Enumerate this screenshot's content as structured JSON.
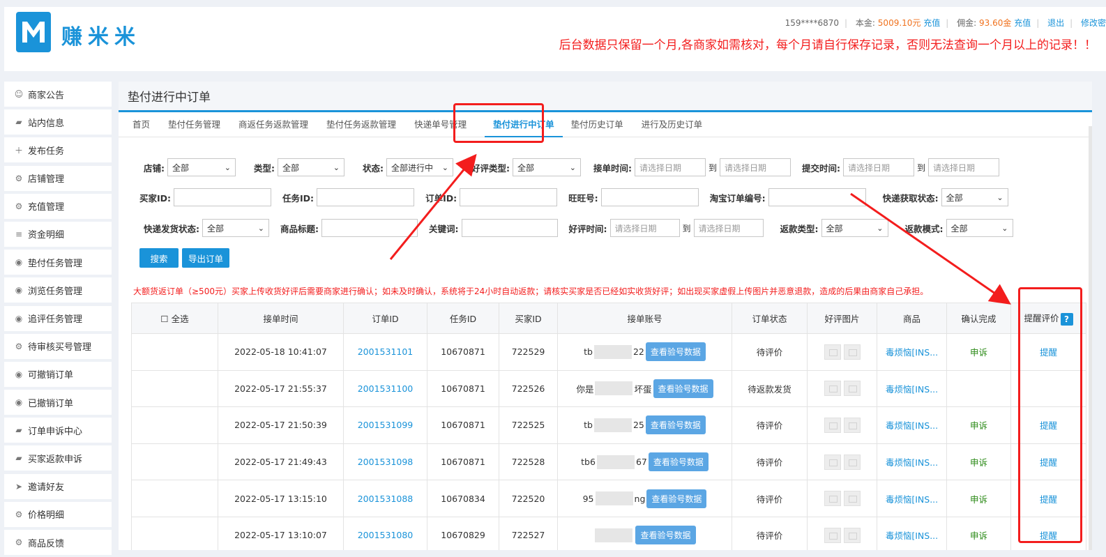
{
  "header": {
    "logo_name": "赚米米",
    "phone": "159****6870",
    "principal_label": "本金:",
    "principal_value": "5009.10元",
    "recharge": "充值",
    "commission_label": "佣金:",
    "commission_value": "93.60金",
    "recharge2": "充值",
    "logout": "退出",
    "modify": "修改密",
    "notice": "后台数据只保留一个月,各商家如需核对，每个月请自行保存记录，否则无法查询一个月以上的记录！！"
  },
  "sidebar": {
    "items": [
      {
        "label": "商家公告",
        "icon": "smile-icon"
      },
      {
        "label": "站内信息",
        "icon": "message-icon"
      },
      {
        "label": "发布任务",
        "icon": "plus-icon"
      },
      {
        "label": "店铺管理",
        "icon": "gear-icon"
      },
      {
        "label": "充值管理",
        "icon": "gear-icon"
      },
      {
        "label": "资金明细",
        "icon": "database-icon"
      },
      {
        "label": "垫付任务管理",
        "icon": "eye-icon"
      },
      {
        "label": "浏览任务管理",
        "icon": "eye-icon"
      },
      {
        "label": "追评任务管理",
        "icon": "eye-icon"
      },
      {
        "label": "待审核买号管理",
        "icon": "gear-icon"
      },
      {
        "label": "可撤销订单",
        "icon": "eye-icon"
      },
      {
        "label": "已撤销订单",
        "icon": "eye-icon"
      },
      {
        "label": "订单申诉中心",
        "icon": "message-icon"
      },
      {
        "label": "买家返款申诉",
        "icon": "message-icon"
      },
      {
        "label": "邀请好友",
        "icon": "send-icon"
      },
      {
        "label": "价格明细",
        "icon": "gear-icon"
      },
      {
        "label": "商品反馈",
        "icon": "gear-icon"
      }
    ]
  },
  "main": {
    "title": "垫付进行中订单",
    "tabs": [
      "首页",
      "垫付任务管理",
      "商返任务返款管理",
      "垫付任务返款管理",
      "快递单号管理",
      "垫付进行中订单",
      "垫付历史订单",
      "进行及历史订单"
    ],
    "filters": {
      "shop_label": "店铺:",
      "shop_value": "全部",
      "type_label": "类型:",
      "type_value": "全部",
      "status_label": "状态:",
      "status_value": "全部进行中",
      "review_type_label": "好评类型:",
      "review_type_value": "全部",
      "accept_time_label": "接单时间:",
      "submit_time_label": "提交时间:",
      "date_placeholder": "请选择日期",
      "to": "到",
      "buyer_id_label": "买家ID:",
      "task_id_label": "任务ID:",
      "order_id_label": "订单ID:",
      "wangwang_label": "旺旺号:",
      "taobao_no_label": "淘宝订单编号:",
      "express_fetch_label": "快递获取状态:",
      "express_fetch_value": "全部",
      "express_send_label": "快递发货状态:",
      "express_send_value": "全部",
      "goods_title_label": "商品标题:",
      "keyword_label": "关键词:",
      "review_time_label": "好评时间:",
      "refund_type_label": "返款类型:",
      "refund_type_value": "全部",
      "refund_mode_label": "返款模式:",
      "refund_mode_value": "全部"
    },
    "search_btn": "搜索",
    "export_btn": "导出订单",
    "warning": "大额货返订单（≥500元）买家上传收货好评后需要商家进行确认；如未及时确认，系统将于24小时自动返款；请核实买家是否已经如实收货好评；如出现买家虚假上传图片并恶意退款，造成的后果由商家自己承担。",
    "table": {
      "headers": [
        "全选",
        "接单时间",
        "订单ID",
        "任务ID",
        "买家ID",
        "接单账号",
        "订单状态",
        "好评图片",
        "商品",
        "确认完成",
        "提醒评价"
      ],
      "qmark": "?",
      "view_btn": "查看验号数据",
      "rows": [
        {
          "time": "2022-05-18 10:41:07",
          "order_id": "2001531101",
          "task_id": "10670871",
          "buyer_id": "722529",
          "acct_pre": "tb",
          "acct_suf": "22",
          "status": "待评价",
          "goods": "毒烦恼[INS...",
          "confirm": "申诉",
          "remind": "提醒"
        },
        {
          "time": "2022-05-17 21:55:37",
          "order_id": "2001531100",
          "task_id": "10670871",
          "buyer_id": "722526",
          "acct_pre": "你是",
          "acct_suf": "坏蛋",
          "status": "待返款发货",
          "goods": "毒烦恼[INS...",
          "confirm": "",
          "remind": ""
        },
        {
          "time": "2022-05-17 21:50:39",
          "order_id": "2001531099",
          "task_id": "10670871",
          "buyer_id": "722525",
          "acct_pre": "tb",
          "acct_suf": "25",
          "status": "待评价",
          "goods": "毒烦恼[INS...",
          "confirm": "申诉",
          "remind": "提醒"
        },
        {
          "time": "2022-05-17 21:49:43",
          "order_id": "2001531098",
          "task_id": "10670871",
          "buyer_id": "722528",
          "acct_pre": "tb6",
          "acct_suf": "67",
          "status": "待评价",
          "goods": "毒烦恼[INS...",
          "confirm": "申诉",
          "remind": "提醒"
        },
        {
          "time": "2022-05-17 13:15:10",
          "order_id": "2001531088",
          "task_id": "10670834",
          "buyer_id": "722520",
          "acct_pre": "95",
          "acct_suf": "ng",
          "status": "待评价",
          "goods": "毒烦恼[INS...",
          "confirm": "申诉",
          "remind": "提醒"
        },
        {
          "time": "2022-05-17 13:10:07",
          "order_id": "2001531080",
          "task_id": "10670829",
          "buyer_id": "722527",
          "acct_pre": "",
          "acct_suf": "",
          "status": "待评价",
          "goods": "毒烦恼[INS...",
          "confirm": "申诉",
          "remind": "提醒"
        }
      ]
    }
  }
}
